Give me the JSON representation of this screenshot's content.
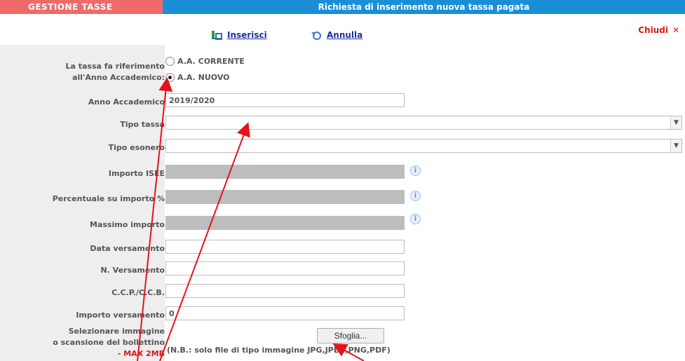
{
  "header": {
    "section": "GESTIONE TASSE",
    "title": "Richiesta di inserimento nuova tassa pagata"
  },
  "toolbar": {
    "insert_label": "Inserisci",
    "cancel_label": "Annulla",
    "close_label": "Chiudi"
  },
  "form": {
    "anno_riferimento_label_1": "La tassa fa riferimento",
    "anno_riferimento_label_2": "all'Anno Accademico:",
    "radio_corrente": "A.A. CORRENTE",
    "radio_nuovo": "A.A. NUOVO",
    "anno_accademico_label": "Anno Accademico",
    "anno_accademico_value": "2019/2020",
    "tipo_tassa_label": "Tipo tassa",
    "tipo_esonero_label": "Tipo esonero",
    "importo_isee_label": "Importo ISEE",
    "percentuale_label": "Percentuale su importo %",
    "massimo_importo_label": "Massimo importo",
    "data_versamento_label": "Data versamento",
    "n_versamento_label": "N. Versamento",
    "ccp_label": "C.C.P./C.C.B.",
    "importo_versamento_label": "Importo versamento",
    "importo_versamento_value": "0",
    "file_label_1": "Selezionare immagine",
    "file_label_2": "o scansione del bollettino",
    "file_label_3": "- MAX 2MB",
    "browse_label": "Sfoglia...",
    "file_note": "(N.B.: solo file di tipo immagine JPG,JPEG,PNG,PDF)"
  },
  "annotation_color": "#e8121a"
}
